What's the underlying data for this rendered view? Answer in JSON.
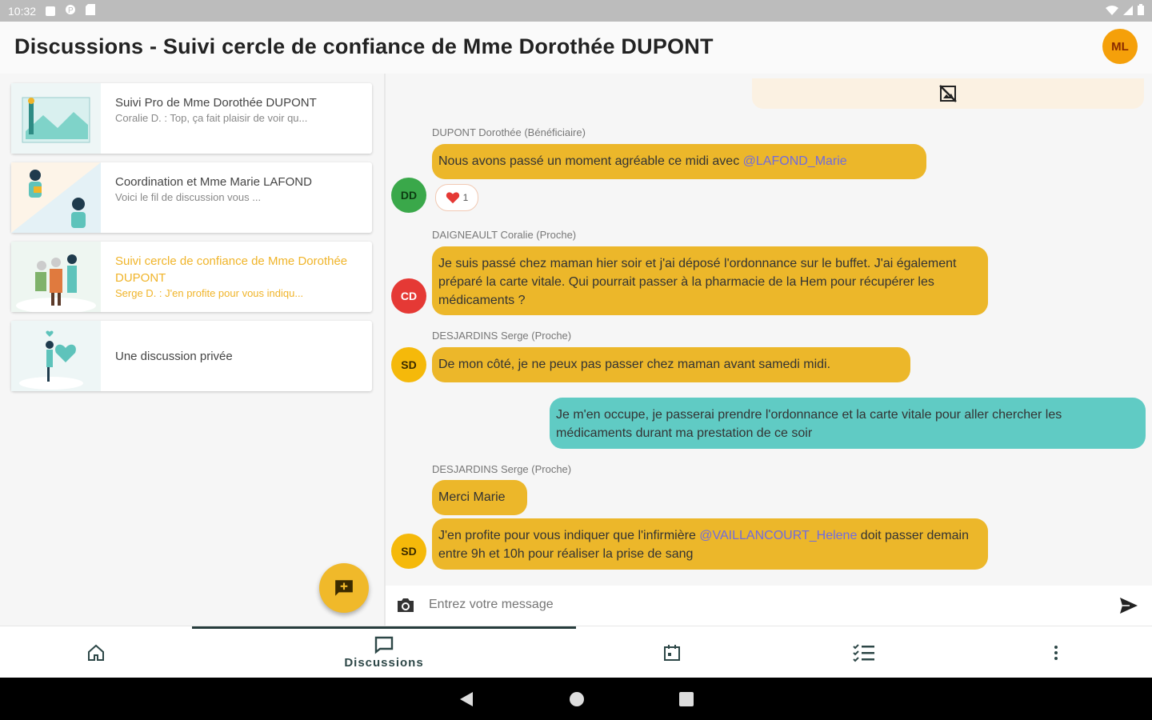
{
  "status_bar": {
    "time": "10:32"
  },
  "header": {
    "title": "Discussions - Suivi cercle de confiance de Mme Dorothée DUPONT",
    "user_initials": "ML"
  },
  "conversations": [
    {
      "name": "Suivi Pro de Mme Dorothée DUPONT",
      "preview": "Coralie D. : Top, ça fait plaisir de voir qu..."
    },
    {
      "name": "Coordination et Mme Marie LAFOND",
      "preview": "Voici le fil de discussion vous ..."
    },
    {
      "name": "Suivi cercle de confiance de Mme Dorothée DUPONT",
      "preview": "Serge D. : J'en profite pour vous indiqu..."
    },
    {
      "name": "Une discussion privée",
      "preview": ""
    }
  ],
  "messages": [
    {
      "sender": "DUPONT Dorothée (Bénéficiaire)",
      "initials": "DD",
      "text": "Nous avons passé un moment agréable ce midi avec ",
      "mention": "@LAFOND_Marie",
      "reaction_count": "1"
    },
    {
      "sender": "DAIGNEAULT Coralie (Proche)",
      "initials": "CD",
      "text": "Je suis passé chez maman hier soir et j'ai déposé l'ordonnance sur le buffet. J'ai également préparé la carte vitale. Qui pourrait passer à la pharmacie de la Hem pour récupérer les médicaments ?"
    },
    {
      "sender": "DESJARDINS Serge (Proche)",
      "initials": "SD",
      "text": "De mon côté, je ne peux pas passer chez maman avant samedi midi."
    },
    {
      "sender": "",
      "initials": "",
      "text": "Je m'en occupe, je passerai prendre l'ordonnance et la carte vitale pour aller chercher les médicaments durant ma prestation de ce soir"
    },
    {
      "sender": "DESJARDINS Serge (Proche)",
      "initials": "SD",
      "text": "Merci Marie"
    },
    {
      "sender": "",
      "initials": "SD",
      "text_before": "J'en profite pour vous indiquer que l'infirmière ",
      "mention": "@VAILLANCOURT_Helene",
      "text_after": " doit passer demain entre 9h et 10h pour réaliser la prise de sang"
    }
  ],
  "composer": {
    "placeholder": "Entrez votre message"
  },
  "bottom_nav": {
    "discussions_label": "Discussions"
  },
  "colors": {
    "accent": "#ecb72a",
    "own_message": "#60cbc4",
    "dd": "#3aa84a",
    "cd": "#e53935",
    "sd": "#f5b90a"
  }
}
